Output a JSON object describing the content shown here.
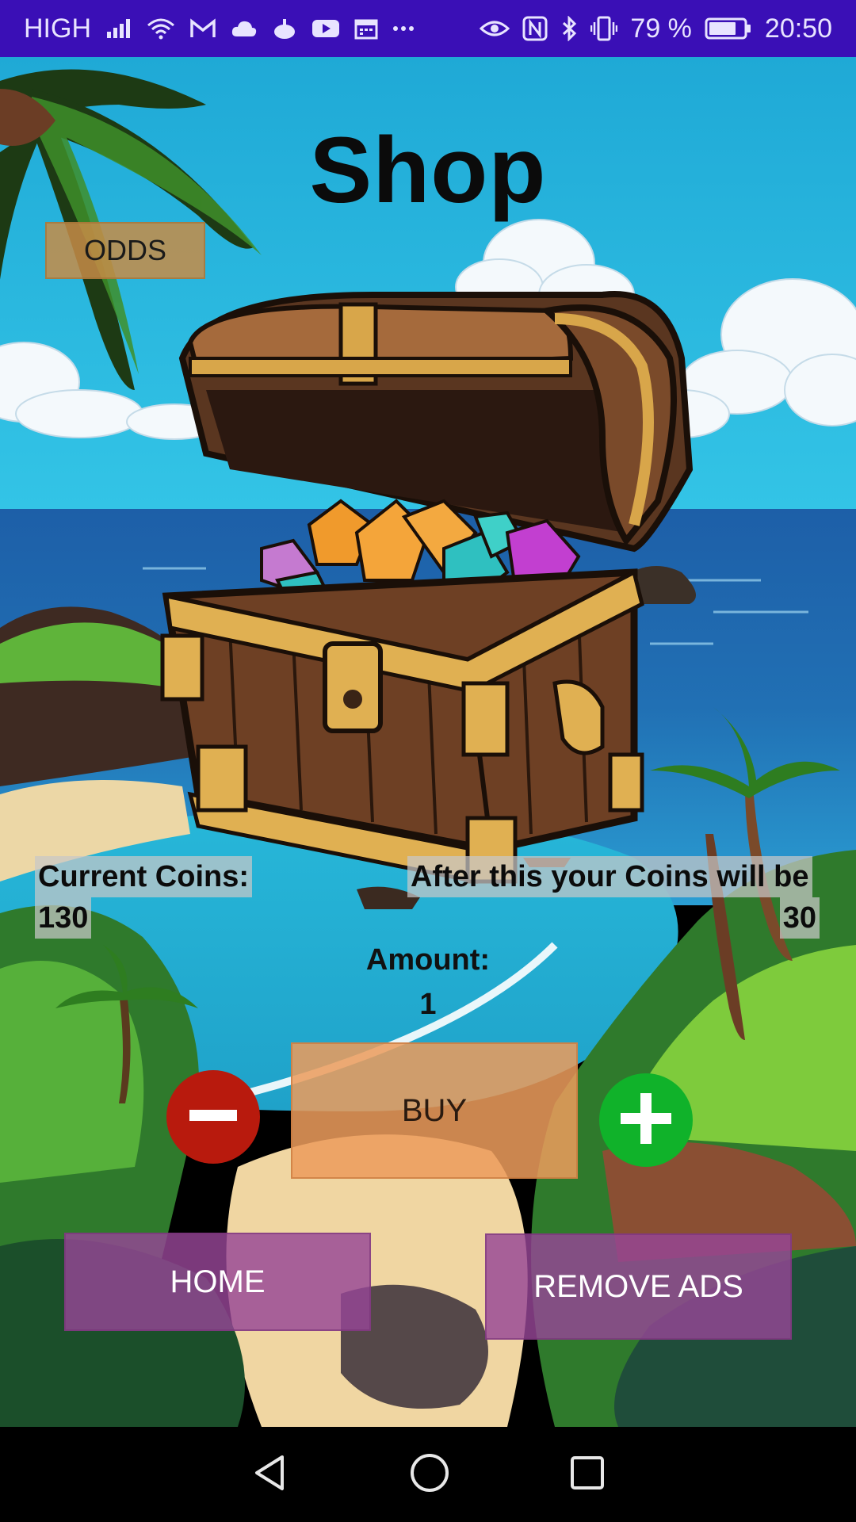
{
  "status_bar": {
    "network": "HIGH",
    "battery_percent": "79 %",
    "time": "20:50",
    "icons_left": [
      "signal-icon",
      "wifi-icon",
      "gmail-icon",
      "cloud-icon",
      "app-icon",
      "youtube-icon",
      "calendar-icon",
      "more-icon"
    ],
    "icons_right": [
      "eye-icon",
      "nfc-icon",
      "bluetooth-icon",
      "vibrate-icon",
      "battery-icon"
    ]
  },
  "shop": {
    "title": "Shop",
    "odds_label": "ODDS",
    "current_coins_label": "Current Coins:",
    "current_coins_value": "130",
    "after_label": "After this your Coins will be",
    "after_value": "30",
    "amount_label": "Amount:",
    "amount_value": "1",
    "buy_label": "BUY",
    "home_label": "HOME",
    "remove_ads_label": "REMOVE ADS"
  },
  "colors": {
    "status_bar": "#3a0fb6",
    "minus_button": "#b81a0d",
    "plus_button": "#10b22a",
    "buy_button": "#ec9c5c",
    "purple_button": "#964696",
    "odds_button": "#c78c46"
  },
  "nav_bar": {
    "icons": [
      "back-icon",
      "home-circle-icon",
      "recents-icon"
    ]
  }
}
